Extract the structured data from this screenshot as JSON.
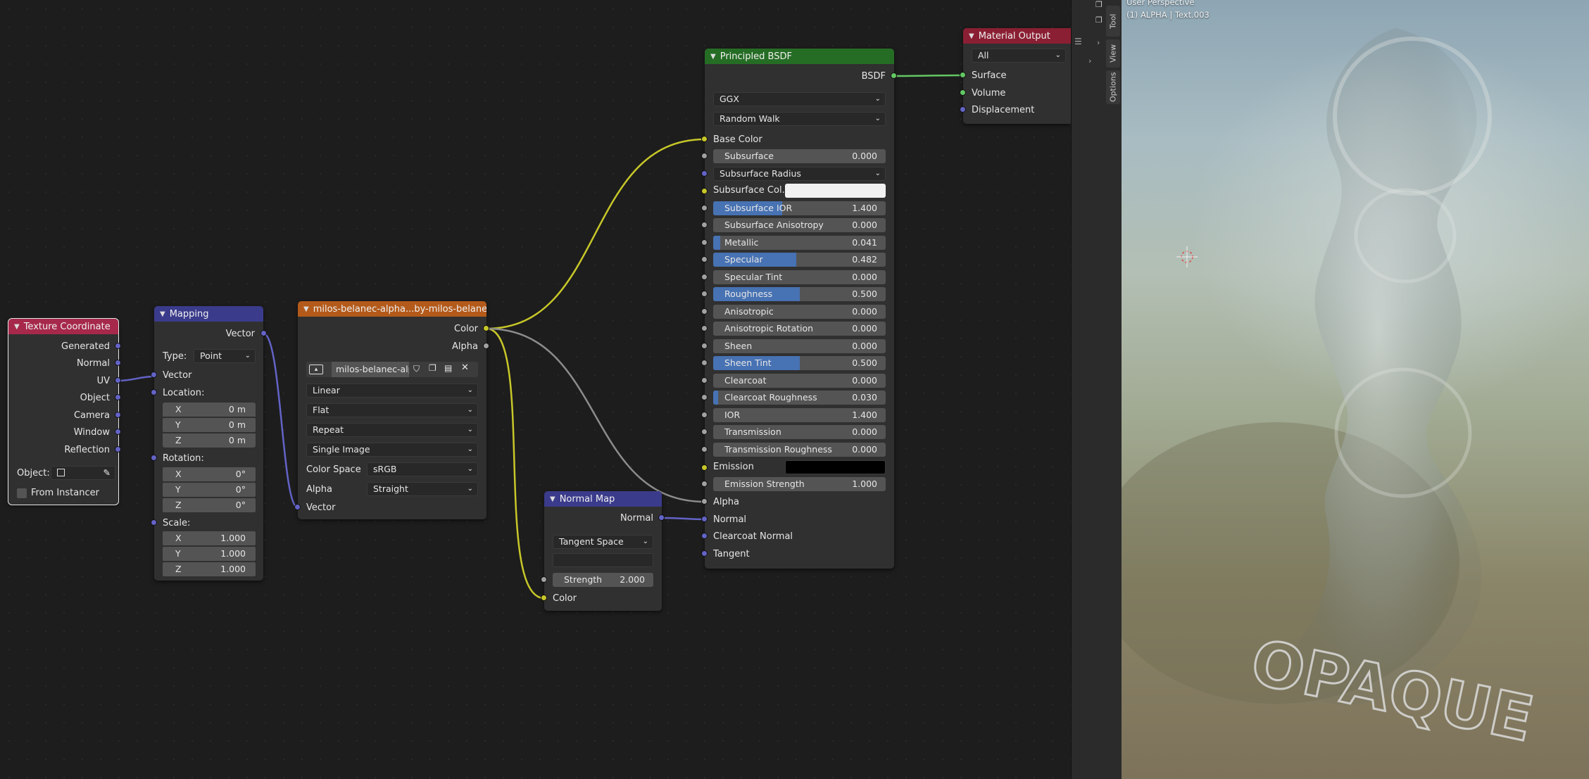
{
  "colors": {
    "editor_bg": "#1d1d1d",
    "node_bg": "#303030",
    "header_input": "#a6284a",
    "header_vector": "#3b3b8c",
    "header_texture": "#b35a1a",
    "header_shader": "#256d25",
    "header_output": "#8a1f33",
    "slider_fill": "#4772b3",
    "socket_color": "#c7c729",
    "socket_vector": "#6363c7",
    "socket_shader": "#63c763",
    "socket_float": "#a1a1a1"
  },
  "texture_coordinate": {
    "title": "Texture Coordinate",
    "outputs": [
      "Generated",
      "Normal",
      "UV",
      "Object",
      "Camera",
      "Window",
      "Reflection"
    ],
    "object_label": "Object:",
    "from_instancer": "From Instancer"
  },
  "mapping": {
    "title": "Mapping",
    "output": "Vector",
    "type_label": "Type:",
    "type_value": "Point",
    "vector_input": "Vector",
    "location_label": "Location:",
    "location": [
      {
        "axis": "X",
        "value": "0 m"
      },
      {
        "axis": "Y",
        "value": "0 m"
      },
      {
        "axis": "Z",
        "value": "0 m"
      }
    ],
    "rotation_label": "Rotation:",
    "rotation": [
      {
        "axis": "X",
        "value": "0°"
      },
      {
        "axis": "Y",
        "value": "0°"
      },
      {
        "axis": "Z",
        "value": "0°"
      }
    ],
    "scale_label": "Scale:",
    "scale": [
      {
        "axis": "X",
        "value": "1.000"
      },
      {
        "axis": "Y",
        "value": "1.000"
      },
      {
        "axis": "Z",
        "value": "1.000"
      }
    ]
  },
  "image_texture": {
    "title": "milos-belanec-alpha...by-milos-belanec.jpg",
    "out_color": "Color",
    "out_alpha": "Alpha",
    "image_name": "milos-belanec-alp...",
    "interpolation": "Linear",
    "projection": "Flat",
    "extension": "Repeat",
    "source": "Single Image",
    "color_space_label": "Color Space",
    "color_space": "sRGB",
    "alpha_label": "Alpha",
    "alpha_value": "Straight",
    "vector_input": "Vector"
  },
  "normal_map": {
    "title": "Normal Map",
    "output": "Normal",
    "space": "Tangent Space",
    "uv_map": "",
    "strength_label": "Strength",
    "strength_value": "2.000",
    "color_input": "Color"
  },
  "principled": {
    "title": "Principled BSDF",
    "output": "BSDF",
    "distribution": "GGX",
    "subsurface_method": "Random Walk",
    "base_color": "Base Color",
    "subsurface_radius": "Subsurface Radius",
    "subsurface_color": "Subsurface Col...",
    "emission": "Emission",
    "sliders": [
      {
        "label": "Subsurface",
        "value": "0.000",
        "fill": 0.0
      },
      {
        "label": "Subsurface IOR",
        "value": "1.400",
        "fill": 0.4
      },
      {
        "label": "Subsurface Anisotropy",
        "value": "0.000",
        "fill": 0.0
      },
      {
        "label": "Metallic",
        "value": "0.041",
        "fill": 0.041
      },
      {
        "label": "Specular",
        "value": "0.482",
        "fill": 0.482
      },
      {
        "label": "Specular Tint",
        "value": "0.000",
        "fill": 0.0
      },
      {
        "label": "Roughness",
        "value": "0.500",
        "fill": 0.5
      },
      {
        "label": "Anisotropic",
        "value": "0.000",
        "fill": 0.0
      },
      {
        "label": "Anisotropic Rotation",
        "value": "0.000",
        "fill": 0.0
      },
      {
        "label": "Sheen",
        "value": "0.000",
        "fill": 0.0
      },
      {
        "label": "Sheen Tint",
        "value": "0.500",
        "fill": 0.5
      },
      {
        "label": "Clearcoat",
        "value": "0.000",
        "fill": 0.0
      },
      {
        "label": "Clearcoat Roughness",
        "value": "0.030",
        "fill": 0.03
      },
      {
        "label": "IOR",
        "value": "1.400",
        "fill": 0.0
      },
      {
        "label": "Transmission",
        "value": "0.000",
        "fill": 0.0
      },
      {
        "label": "Transmission Roughness",
        "value": "0.000",
        "fill": 0.0
      }
    ],
    "emission_strength": {
      "label": "Emission Strength",
      "value": "1.000"
    },
    "inputs_bottom": [
      "Alpha",
      "Normal",
      "Clearcoat Normal",
      "Tangent"
    ],
    "subsurface_color_hex": "#f2f2f2",
    "emission_color_hex": "#000000"
  },
  "material_output": {
    "title": "Material Output",
    "target": "All",
    "inputs": [
      "Surface",
      "Volume",
      "Displacement"
    ]
  },
  "sidebar": {
    "tabs": [
      "Tool",
      "View",
      "Options"
    ]
  },
  "viewport": {
    "line1": "User Perspective",
    "line2": "(1) ALPHA | Text.003",
    "object_text": "OPAQUE"
  }
}
